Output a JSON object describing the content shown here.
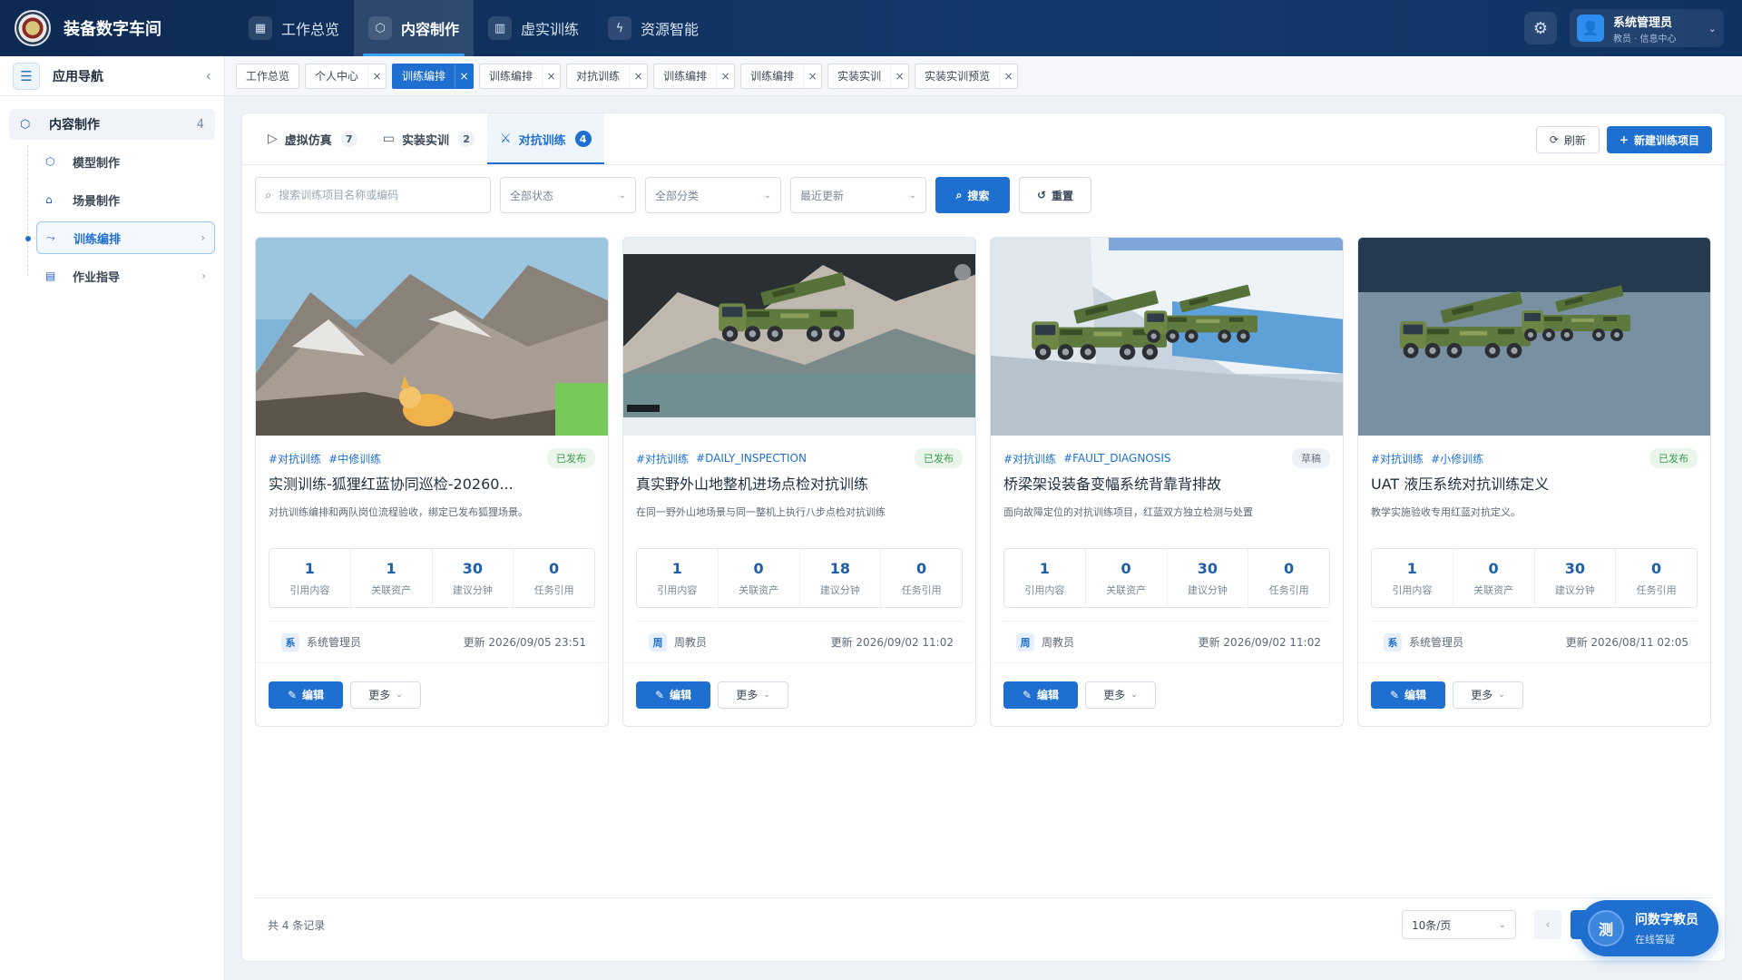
{
  "app": {
    "title": "装备数字车间"
  },
  "topnav": [
    {
      "label": "工作总览",
      "icon": "grid-icon",
      "glyph": "▦",
      "active": false
    },
    {
      "label": "内容制作",
      "icon": "cube-icon",
      "glyph": "⬡",
      "active": true
    },
    {
      "label": "虚实训练",
      "icon": "book-icon",
      "glyph": "▥",
      "active": false
    },
    {
      "label": "资源智能",
      "icon": "bolt-icon",
      "glyph": "ϟ",
      "active": false
    }
  ],
  "user": {
    "name": "系统管理员",
    "role": "教员 · 信息中心"
  },
  "sidebar": {
    "title": "应用导航",
    "group": {
      "label": "内容制作",
      "count": "4"
    },
    "items": [
      {
        "label": "模型制作",
        "icon": "cube-icon",
        "glyph": "⬡",
        "active": false,
        "arrow": ""
      },
      {
        "label": "场景制作",
        "icon": "building-icon",
        "glyph": "⌂",
        "active": false,
        "arrow": ""
      },
      {
        "label": "训练编排",
        "icon": "flow-icon",
        "glyph": "⤳",
        "active": true,
        "arrow": "›"
      },
      {
        "label": "作业指导",
        "icon": "document-icon",
        "glyph": "▤",
        "active": false,
        "arrow": "›"
      }
    ]
  },
  "tabs": [
    {
      "label": "工作总览",
      "closable": false,
      "active": false
    },
    {
      "label": "个人中心",
      "closable": true,
      "active": false
    },
    {
      "label": "训练编排",
      "closable": true,
      "active": true
    },
    {
      "label": "训练编排",
      "closable": true,
      "active": false
    },
    {
      "label": "对抗训练",
      "closable": true,
      "active": false
    },
    {
      "label": "训练编排",
      "closable": true,
      "active": false
    },
    {
      "label": "训练编排",
      "closable": true,
      "active": false
    },
    {
      "label": "实装实训",
      "closable": true,
      "active": false
    },
    {
      "label": "实装实训预览",
      "closable": true,
      "active": false
    }
  ],
  "subtabs": [
    {
      "label": "虚拟仿真",
      "count": "7",
      "icon": "play-icon",
      "glyph": "▷",
      "active": false
    },
    {
      "label": "实装实训",
      "count": "2",
      "icon": "monitor-icon",
      "glyph": "▭",
      "active": false
    },
    {
      "label": "对抗训练",
      "count": "4",
      "icon": "swords-icon",
      "glyph": "⚔",
      "active": true
    }
  ],
  "actions": {
    "refresh": "刷新",
    "create": "新建训练项目"
  },
  "filters": {
    "search_placeholder": "搜索训练项目名称或编码",
    "status": "全部状态",
    "category": "全部分类",
    "sort": "最近更新",
    "search_btn": "搜索",
    "reset_btn": "重置"
  },
  "cards": [
    {
      "tags": [
        "#对抗训练",
        "#中修训练"
      ],
      "status": "已发布",
      "status_type": "pub",
      "title": "实测训练-狐狸红蓝协同巡检-20260...",
      "desc": "对抗训练编排和两队岗位流程验收，绑定已发布狐狸场景。",
      "stats": [
        {
          "n": "1",
          "l": "引用内容"
        },
        {
          "n": "1",
          "l": "关联资产"
        },
        {
          "n": "30",
          "l": "建议分钟"
        },
        {
          "n": "0",
          "l": "任务引用"
        }
      ],
      "avatar": "系",
      "author": "系统管理员",
      "updated": "更新 2026/09/05 23:51",
      "edit": "编辑",
      "more": "更多",
      "scene": "mountain-fox"
    },
    {
      "tags": [
        "#对抗训练",
        "#DAILY_INSPECTION"
      ],
      "status": "已发布",
      "status_type": "pub",
      "title": "真实野外山地整机进场点检对抗训练",
      "desc": "在同一野外山地场景与同一整机上执行八步点检对抗训练",
      "stats": [
        {
          "n": "1",
          "l": "引用内容"
        },
        {
          "n": "0",
          "l": "关联资产"
        },
        {
          "n": "18",
          "l": "建议分钟"
        },
        {
          "n": "0",
          "l": "任务引用"
        }
      ],
      "avatar": "周",
      "author": "周教员",
      "updated": "更新 2026/09/02 11:02",
      "edit": "编辑",
      "more": "更多",
      "scene": "mountain-truck"
    },
    {
      "tags": [
        "#对抗训练",
        "#FAULT_DIAGNOSIS"
      ],
      "status": "草稿",
      "status_type": "draft",
      "title": "桥梁架设装备变幅系统背靠背排故",
      "desc": "面向故障定位的对抗训练项目，红蓝双方独立检测与处置",
      "stats": [
        {
          "n": "1",
          "l": "引用内容"
        },
        {
          "n": "0",
          "l": "关联资产"
        },
        {
          "n": "30",
          "l": "建议分钟"
        },
        {
          "n": "0",
          "l": "任务引用"
        }
      ],
      "avatar": "周",
      "author": "周教员",
      "updated": "更新 2026/09/02 11:02",
      "edit": "编辑",
      "more": "更多",
      "scene": "building-truck"
    },
    {
      "tags": [
        "#对抗训练",
        "#小修训练"
      ],
      "status": "已发布",
      "status_type": "pub",
      "title": "UAT 液压系统对抗训练定义",
      "desc": "教学实施验收专用红蓝对抗定义。",
      "stats": [
        {
          "n": "1",
          "l": "引用内容"
        },
        {
          "n": "0",
          "l": "关联资产"
        },
        {
          "n": "30",
          "l": "建议分钟"
        },
        {
          "n": "0",
          "l": "任务引用"
        }
      ],
      "avatar": "系",
      "author": "系统管理员",
      "updated": "更新 2026/08/11 02:05",
      "edit": "编辑",
      "more": "更多",
      "scene": "studio-truck"
    }
  ],
  "footer": {
    "total": "共 4 条记录",
    "page_size": "10条/页",
    "current_page": "1"
  },
  "assistant": {
    "avatar": "测",
    "title": "问数字教员",
    "subtitle": "在线答疑"
  },
  "colors": {
    "primary": "#1f6fd0",
    "topbar": "#13396b",
    "published": "#3a9a4a"
  }
}
